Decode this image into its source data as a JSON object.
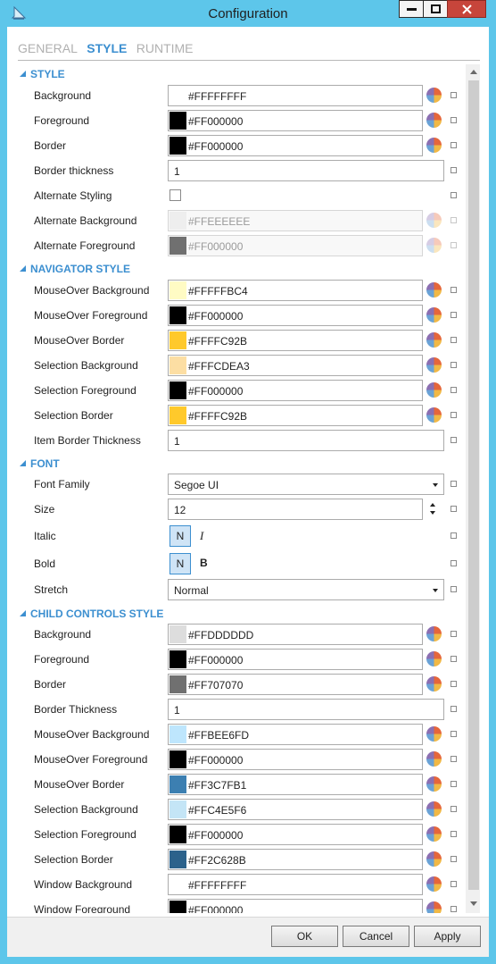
{
  "window": {
    "title": "Configuration"
  },
  "tabs": [
    {
      "label": "GENERAL",
      "active": false
    },
    {
      "label": "STYLE",
      "active": true
    },
    {
      "label": "RUNTIME",
      "active": false
    }
  ],
  "sections": {
    "style": {
      "header": "STYLE",
      "rows": [
        {
          "label": "Background",
          "value": "#FFFFFFFF",
          "swatch": "#FFFFFF"
        },
        {
          "label": "Foreground",
          "value": "#FF000000",
          "swatch": "#000000"
        },
        {
          "label": "Border",
          "value": "#FF000000",
          "swatch": "#000000"
        },
        {
          "label": "Border thickness",
          "value": "1"
        },
        {
          "label": "Alternate Styling",
          "checked": false
        },
        {
          "label": "Alternate Background",
          "value": "#FFEEEEEE",
          "swatch": "#EEEEEE",
          "disabled": true
        },
        {
          "label": "Alternate Foreground",
          "value": "#FF000000",
          "swatch": "#707070",
          "disabled": true
        }
      ]
    },
    "navigator": {
      "header": "NAVIGATOR STYLE",
      "rows": [
        {
          "label": "MouseOver Background",
          "value": "#FFFFFBC4",
          "swatch": "#FFFBC4"
        },
        {
          "label": "MouseOver Foreground",
          "value": "#FF000000",
          "swatch": "#000000"
        },
        {
          "label": "MouseOver Border",
          "value": "#FFFFC92B",
          "swatch": "#FFC92B"
        },
        {
          "label": "Selection Background",
          "value": "#FFFCDEA3",
          "swatch": "#FCDEA3"
        },
        {
          "label": "Selection Foreground",
          "value": "#FF000000",
          "swatch": "#000000"
        },
        {
          "label": "Selection Border",
          "value": "#FFFFC92B",
          "swatch": "#FFC92B"
        },
        {
          "label": "Item Border Thickness",
          "value": "1"
        }
      ]
    },
    "font": {
      "header": "FONT",
      "font_family": {
        "label": "Font Family",
        "value": "Segoe UI"
      },
      "size": {
        "label": "Size",
        "value": "12"
      },
      "italic": {
        "label": "Italic",
        "toggle": "N",
        "glyph": "I"
      },
      "bold": {
        "label": "Bold",
        "toggle": "N",
        "glyph": "B"
      },
      "stretch": {
        "label": "Stretch",
        "value": "Normal"
      }
    },
    "child": {
      "header": "CHILD CONTROLS STYLE",
      "rows": [
        {
          "label": "Background",
          "value": "#FFDDDDDD",
          "swatch": "#DDDDDD"
        },
        {
          "label": "Foreground",
          "value": "#FF000000",
          "swatch": "#000000"
        },
        {
          "label": "Border",
          "value": "#FF707070",
          "swatch": "#707070"
        },
        {
          "label": "Border Thickness",
          "value": "1"
        },
        {
          "label": "MouseOver Background",
          "value": "#FFBEE6FD",
          "swatch": "#BEE6FD"
        },
        {
          "label": "MouseOver Foreground",
          "value": "#FF000000",
          "swatch": "#000000"
        },
        {
          "label": "MouseOver Border",
          "value": "#FF3C7FB1",
          "swatch": "#3C7FB1"
        },
        {
          "label": "Selection Background",
          "value": "#FFC4E5F6",
          "swatch": "#C4E5F6"
        },
        {
          "label": "Selection Foreground",
          "value": "#FF000000",
          "swatch": "#000000"
        },
        {
          "label": "Selection Border",
          "value": "#FF2C628B",
          "swatch": "#2C628B"
        },
        {
          "label": "Window Background",
          "value": "#FFFFFFFF",
          "swatch": "#FFFFFF"
        },
        {
          "label": "Window Foreground",
          "value": "#FF000000",
          "swatch": "#000000"
        }
      ]
    }
  },
  "buttons": {
    "ok": "OK",
    "cancel": "Cancel",
    "apply": "Apply"
  },
  "colors": {
    "accent": "#3C8FD0",
    "titlebar": "#5DC6EA",
    "close": "#C7453B"
  },
  "icons": [
    "app-icon",
    "minimize-icon",
    "maximize-icon",
    "close-icon",
    "color-picker-icon",
    "chevron-down-icon",
    "spin-up-icon",
    "spin-down-icon",
    "collapse-triangle-icon"
  ]
}
